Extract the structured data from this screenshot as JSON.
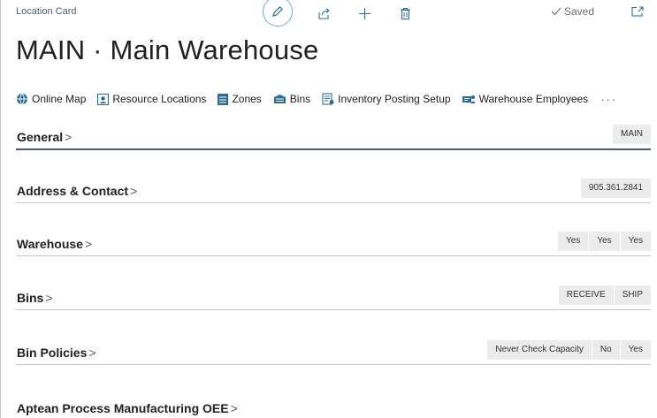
{
  "header": {
    "card_label": "Location Card",
    "saved_label": "Saved",
    "page_title": "MAIN · Main Warehouse"
  },
  "actions": [
    {
      "label": "Online Map",
      "icon": "globe-icon"
    },
    {
      "label": "Resource Locations",
      "icon": "resource-locations-icon"
    },
    {
      "label": "Zones",
      "icon": "zones-icon"
    },
    {
      "label": "Bins",
      "icon": "bins-icon"
    },
    {
      "label": "Inventory Posting Setup",
      "icon": "posting-setup-icon"
    },
    {
      "label": "Warehouse Employees",
      "icon": "employees-icon"
    }
  ],
  "more_label": "···",
  "sections": {
    "general": {
      "title": "General",
      "chips": [
        "MAIN"
      ]
    },
    "address": {
      "title": "Address & Contact",
      "chips": [
        "905.361.2841"
      ]
    },
    "warehouse": {
      "title": "Warehouse",
      "chips": [
        "Yes",
        "Yes",
        "Yes"
      ]
    },
    "bins": {
      "title": "Bins",
      "chips": [
        "RECEIVE",
        "SHIP"
      ]
    },
    "bin_policies": {
      "title": "Bin Policies",
      "chips": [
        "Never Check Capacity",
        "No",
        "Yes"
      ]
    },
    "aptean": {
      "title": "Aptean Process Manufacturing OEE",
      "chips": []
    }
  },
  "colors": {
    "accent": "#2c6b8f",
    "edit_ring": "#6fb1ba",
    "chip_bg": "#ececec"
  }
}
